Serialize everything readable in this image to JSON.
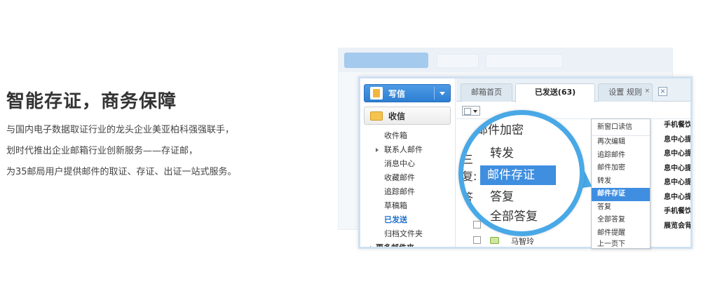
{
  "headline": "智能存证，商务保障",
  "description": [
    "与国内电子数据取证行业的龙头企业美亚柏科强强联手，",
    "划时代推出企业邮箱行业创新服务——存证邮，",
    "为35邮局用户提供邮件的取证、存证、出证一站式服务。"
  ],
  "sidebar": {
    "write_label": "写信",
    "receive_label": "收信",
    "folders": [
      "收件箱",
      "联系人邮件",
      "消息中心",
      "收藏邮件",
      "追踪邮件",
      "草稿箱",
      "已发送",
      "归档文件夹",
      "更多邮件夹"
    ],
    "active_folder": "已发送"
  },
  "tabs": [
    {
      "label": "邮箱首页"
    },
    {
      "label": "已发送(63)"
    },
    {
      "label": "设置 规则"
    }
  ],
  "mail_rows": [
    {
      "sender": "马智玲",
      "subject": ""
    }
  ],
  "row_fragments": [
    "手机餐饮模板",
    "息中心提示的",
    "息中心提示的",
    "息中心提示的",
    "息中心提示的",
    "息中心提示的",
    "手机餐饮模板",
    "展览会背景板"
  ],
  "context_menu": {
    "items": [
      "新窗口读信",
      "再次编辑",
      "追踪邮件",
      "邮件加密",
      "转发",
      "邮件存证",
      "答复",
      "全部答复",
      "邮件提醒",
      "上一页下"
    ],
    "highlighted": "邮件存证"
  },
  "magnifier": {
    "items": [
      "邮件加密",
      "转发",
      "邮件存证",
      "答复",
      "全部答复"
    ],
    "highlighted": "邮件存证"
  },
  "colors": {
    "accent": "#3f8ee0",
    "magnifier_ring": "#49a8e6"
  }
}
